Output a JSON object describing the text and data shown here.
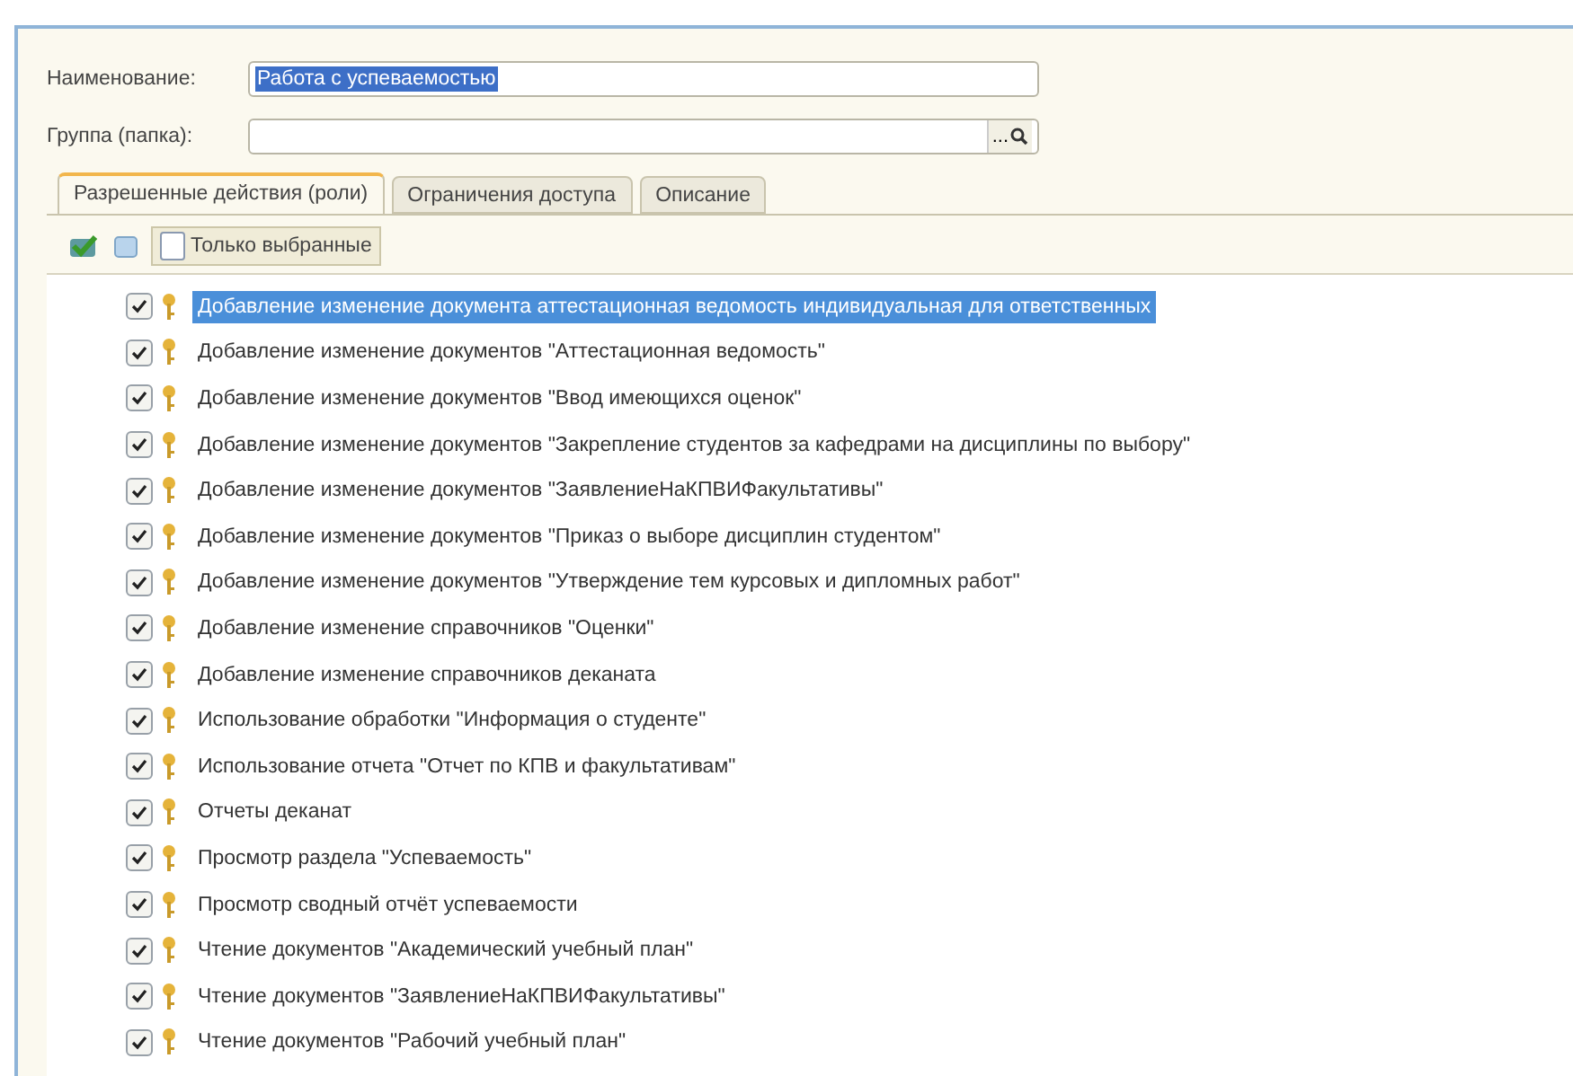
{
  "form": {
    "name_label": "Наименование:",
    "name_value": "Работа с успеваемостью",
    "group_label": "Группа (папка):",
    "group_button": "..."
  },
  "tabs": [
    {
      "label": "Разрешенные действия (роли)",
      "selected": true
    },
    {
      "label": "Ограничения доступа",
      "selected": false
    },
    {
      "label": "Описание",
      "selected": false
    }
  ],
  "toolbar": {
    "only_selected": {
      "label": "Только выбранные",
      "checked": false
    }
  },
  "roles": [
    {
      "label": "Добавление изменение документа аттестационная ведомость индивидуальная для ответственных",
      "checked": true,
      "selected": true
    },
    {
      "label": "Добавление изменение документов \"Аттестационная ведомость\"",
      "checked": true,
      "selected": false
    },
    {
      "label": "Добавление изменение документов \"Ввод имеющихся оценок\"",
      "checked": true,
      "selected": false
    },
    {
      "label": "Добавление изменение документов \"Закрепление студентов за кафедрами на дисциплины по выбору\"",
      "checked": true,
      "selected": false
    },
    {
      "label": "Добавление изменение документов \"ЗаявлениеНаКПВИФакультативы\"",
      "checked": true,
      "selected": false
    },
    {
      "label": "Добавление изменение документов \"Приказ о выборе дисциплин студентом\"",
      "checked": true,
      "selected": false
    },
    {
      "label": "Добавление изменение документов \"Утверждение тем курсовых и дипломных работ\"",
      "checked": true,
      "selected": false
    },
    {
      "label": "Добавление изменение справочников \"Оценки\"",
      "checked": true,
      "selected": false
    },
    {
      "label": "Добавление изменение справочников деканата",
      "checked": true,
      "selected": false
    },
    {
      "label": "Использование обработки \"Информация о студенте\"",
      "checked": true,
      "selected": false
    },
    {
      "label": "Использование отчета \"Отчет по КПВ и факультативам\"",
      "checked": true,
      "selected": false
    },
    {
      "label": "Отчеты деканат",
      "checked": true,
      "selected": false
    },
    {
      "label": "Просмотр раздела \"Успеваемость\"",
      "checked": true,
      "selected": false
    },
    {
      "label": "Просмотр сводный отчёт успеваемости",
      "checked": true,
      "selected": false
    },
    {
      "label": "Чтение документов \"Академический учебный план\"",
      "checked": true,
      "selected": false
    },
    {
      "label": "Чтение документов \"ЗаявлениеНаКПВИФакультативы\"",
      "checked": true,
      "selected": false
    },
    {
      "label": "Чтение документов \"Рабочий учебный план\"",
      "checked": true,
      "selected": false
    }
  ]
}
